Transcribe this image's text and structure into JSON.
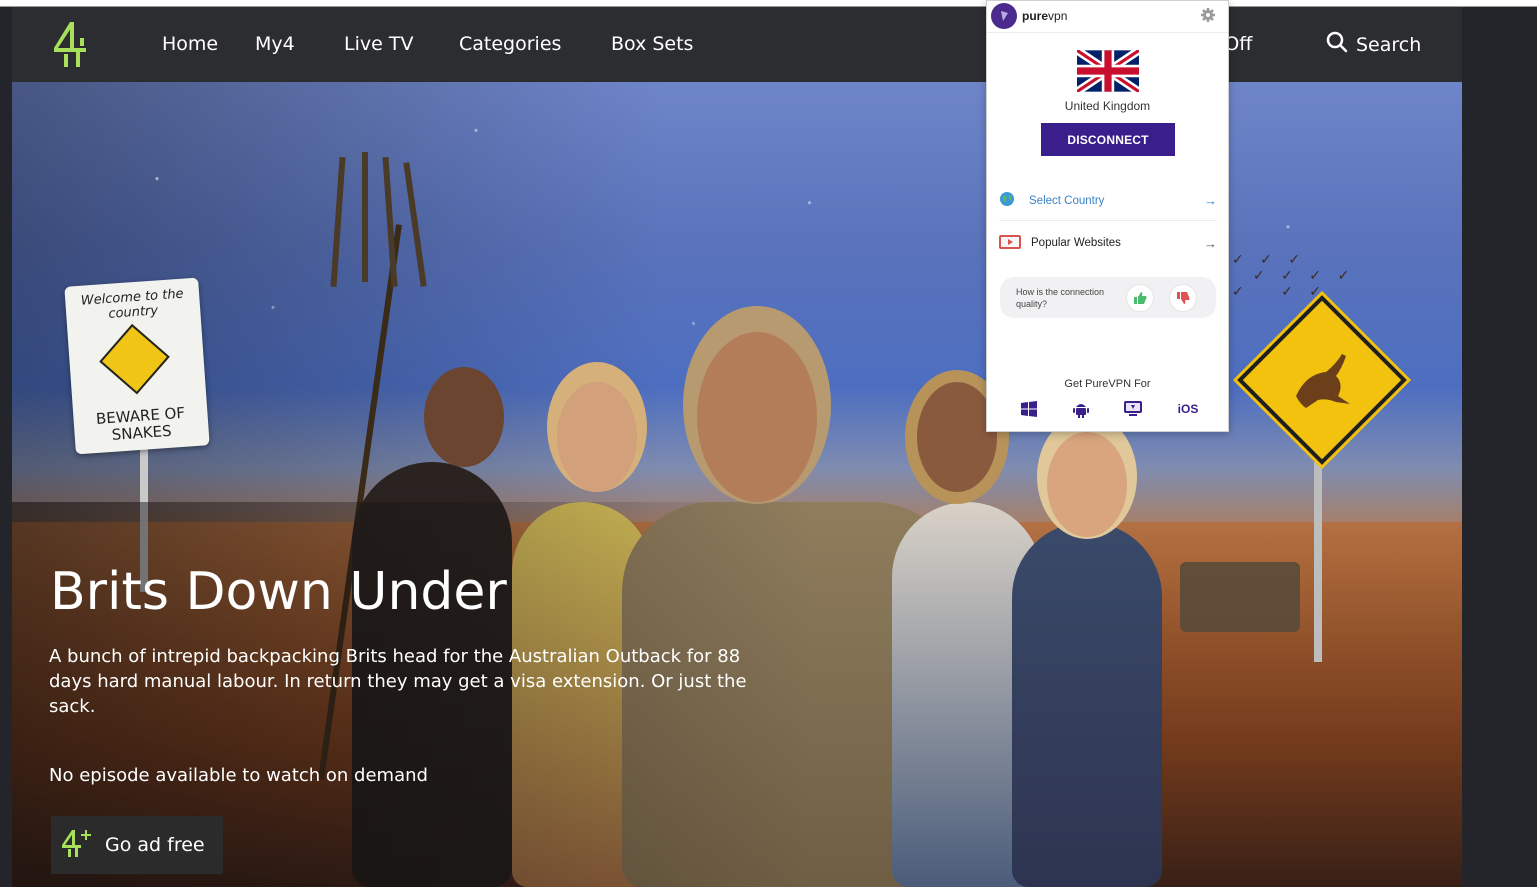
{
  "nav": {
    "items": [
      "Home",
      "My4",
      "Live TV",
      "Categories",
      "Box Sets"
    ],
    "subtitles_partial": "s: Off",
    "search_label": "Search"
  },
  "hero": {
    "title": "Brits Down Under",
    "description": "A bunch of intrepid backpacking Brits head for the Australian Outback for 88 days hard manual labour. In return they may get a visa extension. Or just the sack.",
    "availability": "No episode available to watch on demand",
    "ad_free_label": "Go ad free",
    "sign_snake_top": "Welcome to the country",
    "sign_snake_bottom": "BEWARE OF SNAKES"
  },
  "vpn": {
    "brand_bold": "pure",
    "brand_rest": "vpn",
    "country": "United Kingdom",
    "disconnect_label": "DISCONNECT",
    "select_country_label": "Select Country",
    "popular_websites_label": "Popular Websites",
    "quality_question": "How is the connection quality?",
    "get_for_label": "Get PureVPN For",
    "platforms": [
      "windows",
      "android",
      "mac",
      "iOS"
    ],
    "colors": {
      "primary": "#3a1f8c",
      "link": "#3b82c4"
    }
  },
  "colors": {
    "channel4_green": "#a8e05c",
    "nav_bg": "#2c2d31"
  }
}
